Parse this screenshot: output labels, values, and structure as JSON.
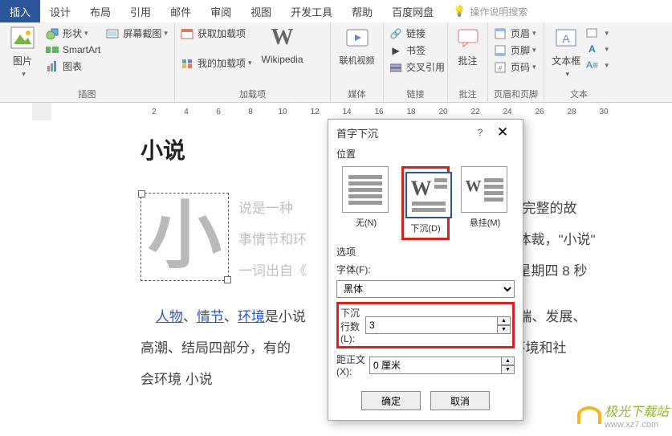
{
  "tabs": [
    "插入",
    "设计",
    "布局",
    "引用",
    "邮件",
    "审阅",
    "视图",
    "开发工具",
    "帮助",
    "百度网盘"
  ],
  "search_hint": "操作说明搜索",
  "ribbon": {
    "pic": "图片",
    "shapes": "形状",
    "smartart": "SmartArt",
    "chart": "图表",
    "screenshot": "屏幕截图",
    "group_illus": "插图",
    "get_addins": "获取加载项",
    "my_addins": "我的加载项",
    "wikipedia": "Wikipedia",
    "group_addin": "加载项",
    "online_video": "联机视频",
    "group_media": "媒体",
    "link": "链接",
    "bookmark": "书签",
    "crossref": "交叉引用",
    "group_link": "链接",
    "comment": "批注",
    "group_comment": "批注",
    "header": "页眉",
    "footer": "页脚",
    "pagenum": "页码",
    "group_hf": "页眉和页脚",
    "textbox": "文本框",
    "group_text": "文本"
  },
  "ruler_marks": [
    "2",
    "4",
    "6",
    "8",
    "10",
    "12",
    "14",
    "16",
    "18",
    "20",
    "22",
    "24",
    "26",
    "28",
    "30"
  ],
  "doc": {
    "heading": "小说",
    "dropcap": "小",
    "line1a": "说是一种",
    "line1b": "通过完整的故",
    "line2a": "事情节和环",
    "line2b": "学体裁，\"小说\"",
    "line3a": "一词出自《",
    "line3b": "日星期四 8 秒",
    "p2_links": [
      "人物",
      "情节",
      "环境"
    ],
    "p2_a": "是小说",
    "p2_b": "开端、发展、",
    "p3_a": "高潮、结局四部分，有的",
    "p3_b": "自然环境和社",
    "p4": "会环境  小说"
  },
  "dialog": {
    "title": "首字下沉",
    "section_pos": "位置",
    "pos_none": "无(N)",
    "pos_drop": "下沉(D)",
    "pos_margin": "悬挂(M)",
    "section_opt": "选项",
    "font_label": "字体(F):",
    "font_value": "黑体",
    "lines_label": "下沉行数(L):",
    "lines_value": "3",
    "dist_label": "距正文(X):",
    "dist_value": "0 厘米",
    "ok": "确定",
    "cancel": "取消"
  },
  "watermark": {
    "brand": "极光下载站",
    "url": "www.xz7.com"
  }
}
